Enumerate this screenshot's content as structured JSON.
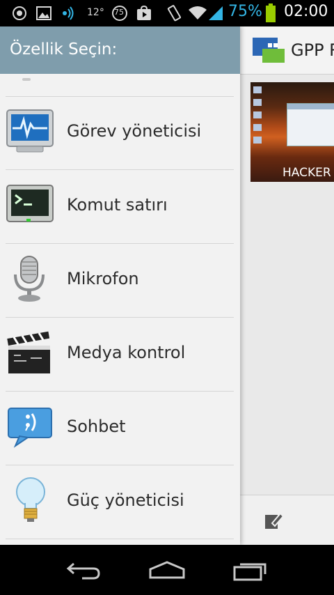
{
  "status_bar": {
    "temperature": "12°",
    "circle_badge": "75",
    "battery_percent": "75%",
    "clock": "02:00"
  },
  "app": {
    "title": "GPP R"
  },
  "thumbnail": {
    "caption": "HACKER"
  },
  "drawer": {
    "title": "Özellik Seçin:",
    "items": [
      {
        "label": "Görev yöneticisi",
        "icon": "task-manager-icon"
      },
      {
        "label": "Komut satırı",
        "icon": "terminal-icon"
      },
      {
        "label": "Mikrofon",
        "icon": "microphone-icon"
      },
      {
        "label": "Medya kontrol",
        "icon": "clapperboard-icon"
      },
      {
        "label": "Sohbet",
        "icon": "chat-bubble-icon"
      },
      {
        "label": "Güç yöneticisi",
        "icon": "light-bulb-icon"
      }
    ]
  },
  "colors": {
    "drawer_header": "#7f9dac",
    "battery_accent": "#33b5e5",
    "battery_fill": "#99cc00"
  }
}
